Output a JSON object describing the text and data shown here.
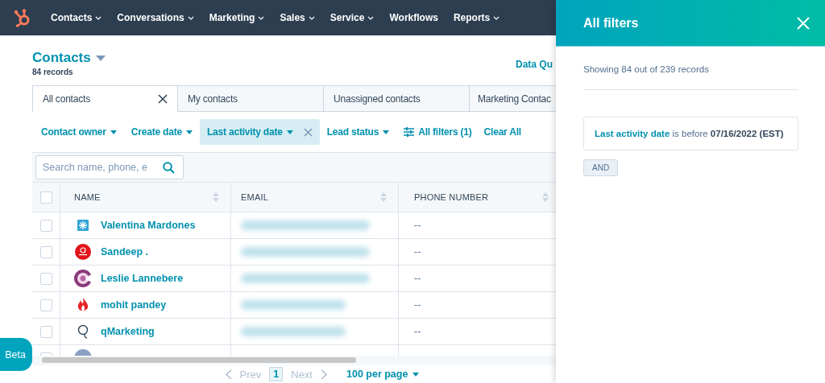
{
  "nav": {
    "items": [
      {
        "label": "Contacts",
        "caret": true
      },
      {
        "label": "Conversations",
        "caret": true
      },
      {
        "label": "Marketing",
        "caret": true
      },
      {
        "label": "Sales",
        "caret": true
      },
      {
        "label": "Service",
        "caret": true
      },
      {
        "label": "Workflows",
        "caret": false
      },
      {
        "label": "Reports",
        "caret": true
      }
    ]
  },
  "page": {
    "title": "Contacts",
    "subtitle": "84 records",
    "action": "Data Qu"
  },
  "tabs": [
    {
      "label": "All contacts",
      "selected": true,
      "closable": true
    },
    {
      "label": "My contacts",
      "selected": false,
      "closable": false
    },
    {
      "label": "Unassigned contacts",
      "selected": false,
      "closable": false
    },
    {
      "label": "Marketing Contac",
      "selected": false,
      "closable": false
    }
  ],
  "filters": [
    {
      "kind": "dropdown",
      "label": "Contact owner",
      "active": false
    },
    {
      "kind": "dropdown",
      "label": "Create date",
      "active": false
    },
    {
      "kind": "dropdown",
      "label": "Last activity date",
      "active": true
    },
    {
      "kind": "dropdown",
      "label": "Lead status",
      "active": false
    },
    {
      "kind": "all",
      "label": "All filters (1)"
    },
    {
      "kind": "clear",
      "label": "Clear All"
    }
  ],
  "search": {
    "placeholder": "Search name, phone, e"
  },
  "table": {
    "columns": [
      "NAME",
      "EMAIL",
      "PHONE NUMBER"
    ],
    "all_checked": false,
    "rows": [
      {
        "kind": "square-star",
        "name": "Valentina Mardones",
        "phone": "--",
        "checked": false
      },
      {
        "kind": "red-circle",
        "name": "Sandeep .",
        "phone": "--",
        "checked": false
      },
      {
        "kind": "purple-ring",
        "name": "Leslie Lannebere",
        "phone": "--",
        "checked": false
      },
      {
        "kind": "flame",
        "name": "mohit pandey",
        "phone": "--",
        "checked": false
      },
      {
        "kind": "q-mark",
        "name": "qMarketing",
        "phone": "--",
        "checked": false
      },
      {
        "kind": "gray-circle",
        "checked": false
      }
    ]
  },
  "pagination": {
    "prev": {
      "label": "Prev",
      "disabled": true
    },
    "page": "1",
    "next": {
      "label": "Next",
      "disabled": true
    },
    "per_page": "100 per page"
  },
  "beta": "Beta",
  "panel": {
    "title": "All filters",
    "summary": "Showing 84 out of 239 records",
    "condition": {
      "property": "Last activity date",
      "operator": "is before",
      "value": "07/16/2022 (EST)"
    },
    "join": "AND"
  }
}
